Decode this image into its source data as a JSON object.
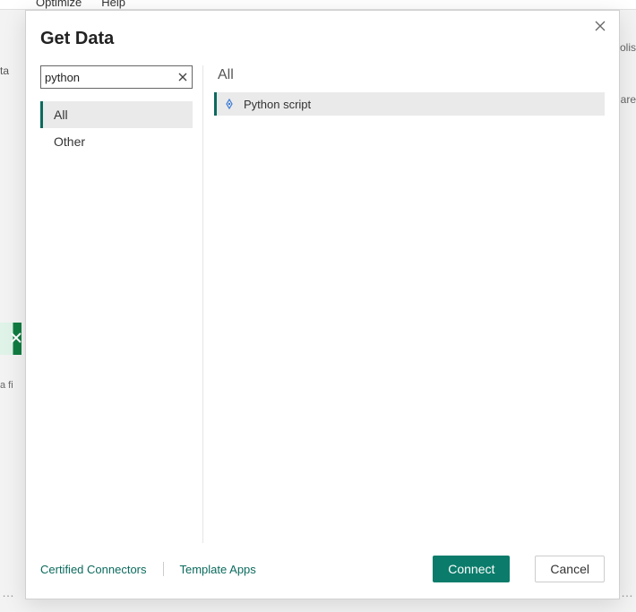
{
  "background": {
    "menu": {
      "item1": "Optimize",
      "item2": "Help"
    },
    "left_fragment1": "ta",
    "af": "a fi",
    "right_fragment_top": "olis",
    "right_fragment_bottom": "are"
  },
  "dialog": {
    "title": "Get Data",
    "search": {
      "value": "python"
    },
    "categories": [
      {
        "label": "All",
        "selected": true
      },
      {
        "label": "Other",
        "selected": false
      }
    ],
    "results": {
      "header": "All",
      "items": [
        {
          "label": "Python script",
          "icon": "python-script-icon"
        }
      ]
    },
    "footer": {
      "certified": "Certified Connectors",
      "template": "Template Apps",
      "connect": "Connect",
      "cancel": "Cancel"
    }
  }
}
